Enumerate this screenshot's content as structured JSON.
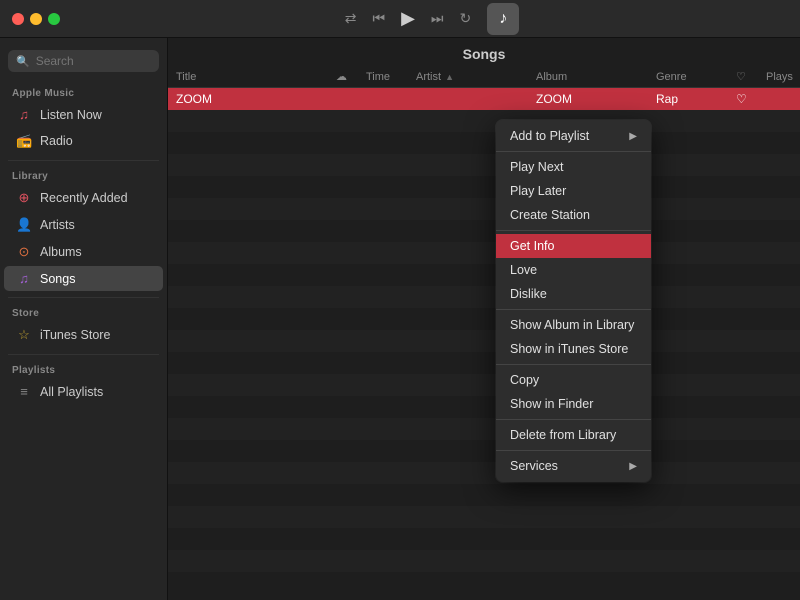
{
  "titlebar": {
    "traffic_lights": [
      "close",
      "minimize",
      "maximize"
    ],
    "controls": {
      "shuffle": "⇄",
      "prev": "«",
      "play": "▶",
      "next": "»",
      "repeat": "↻"
    },
    "music_icon": "♪"
  },
  "sidebar": {
    "search_placeholder": "Search",
    "sections": [
      {
        "title": "Apple Music",
        "items": [
          {
            "label": "Listen Now",
            "icon": "♫",
            "icon_class": "icon-red",
            "active": false
          },
          {
            "label": "Radio",
            "icon": "📻",
            "icon_class": "icon-pink",
            "active": false
          }
        ]
      },
      {
        "title": "Library",
        "items": [
          {
            "label": "Recently Added",
            "icon": "↓",
            "icon_class": "icon-red",
            "active": false
          },
          {
            "label": "Artists",
            "icon": "♪",
            "icon_class": "icon-pink",
            "active": false
          },
          {
            "label": "Albums",
            "icon": "⊙",
            "icon_class": "icon-orange",
            "active": false
          },
          {
            "label": "Songs",
            "icon": "♫",
            "icon_class": "icon-purple",
            "active": true
          }
        ]
      },
      {
        "title": "Store",
        "items": [
          {
            "label": "iTunes Store",
            "icon": "☆",
            "icon_class": "icon-star",
            "active": false
          }
        ]
      },
      {
        "title": "Playlists",
        "items": [
          {
            "label": "All Playlists",
            "icon": "≡",
            "icon_class": "icon-list",
            "active": false
          }
        ]
      }
    ]
  },
  "content": {
    "title": "Songs",
    "columns": [
      "Title",
      "Time",
      "Artist",
      "Album",
      "Genre",
      "Plays"
    ],
    "rows": [
      {
        "title": "ZOOM",
        "time": "",
        "artist": "",
        "album": "ZOOM",
        "genre": "Rap",
        "heart": "♡",
        "plays": "",
        "selected": true
      }
    ]
  },
  "context_menu": {
    "items": [
      {
        "label": "Add to Playlist",
        "has_arrow": true,
        "highlighted": false,
        "separator_after": false
      },
      {
        "label": "",
        "is_separator": true
      },
      {
        "label": "Play Next",
        "has_arrow": false,
        "highlighted": false,
        "separator_after": false
      },
      {
        "label": "Play Later",
        "has_arrow": false,
        "highlighted": false,
        "separator_after": false
      },
      {
        "label": "Create Station",
        "has_arrow": false,
        "highlighted": false,
        "separator_after": true
      },
      {
        "label": "Get Info",
        "has_arrow": false,
        "highlighted": true,
        "separator_after": false
      },
      {
        "label": "Love",
        "has_arrow": false,
        "highlighted": false,
        "separator_after": false
      },
      {
        "label": "Dislike",
        "has_arrow": false,
        "highlighted": false,
        "separator_after": true
      },
      {
        "label": "Show Album in Library",
        "has_arrow": false,
        "highlighted": false,
        "separator_after": false
      },
      {
        "label": "Show in iTunes Store",
        "has_arrow": false,
        "highlighted": false,
        "separator_after": true
      },
      {
        "label": "Copy",
        "has_arrow": false,
        "highlighted": false,
        "separator_after": false
      },
      {
        "label": "Show in Finder",
        "has_arrow": false,
        "highlighted": false,
        "separator_after": true
      },
      {
        "label": "Delete from Library",
        "has_arrow": false,
        "highlighted": false,
        "separator_after": true
      },
      {
        "label": "Services",
        "has_arrow": true,
        "highlighted": false,
        "separator_after": false
      }
    ]
  }
}
